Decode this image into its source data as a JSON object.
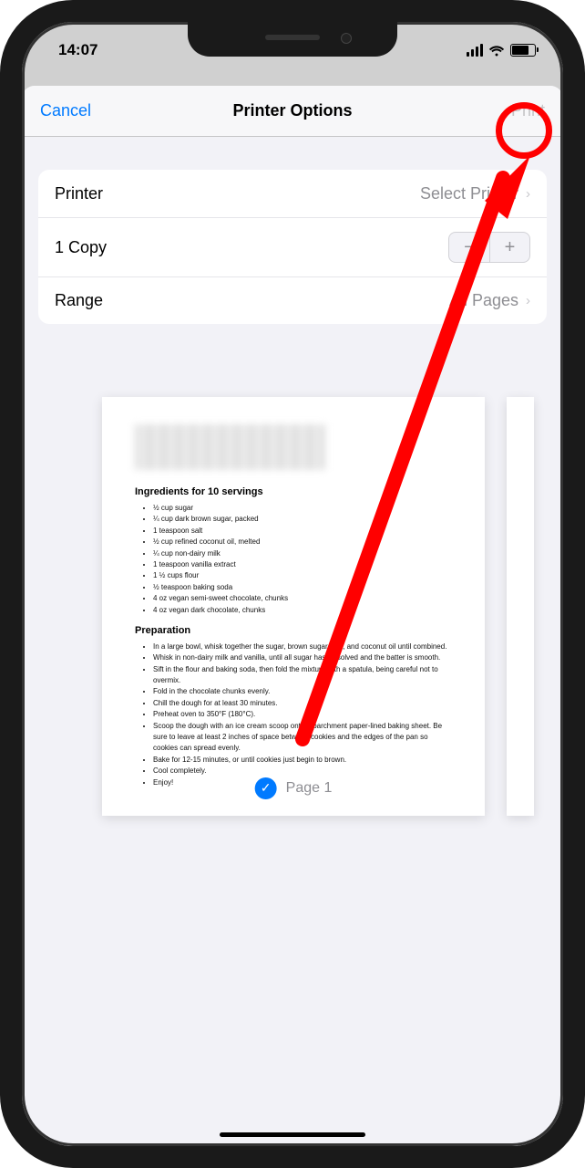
{
  "statusBar": {
    "time": "14:07"
  },
  "nav": {
    "cancel": "Cancel",
    "title": "Printer Options",
    "print": "Print"
  },
  "settings": {
    "printer": {
      "label": "Printer",
      "value": "Select Printer"
    },
    "copies": {
      "label": "1 Copy",
      "minus": "−",
      "plus": "+"
    },
    "range": {
      "label": "Range",
      "value": "All Pages"
    }
  },
  "document": {
    "ingredientsHeading": "Ingredients for 10 servings",
    "ingredients": [
      "½ cup sugar",
      "¼ cup dark brown sugar, packed",
      "1 teaspoon salt",
      "½ cup refined coconut oil, melted",
      "¼ cup non-dairy milk",
      "1 teaspoon vanilla extract",
      "1 ½ cups flour",
      "½ teaspoon baking soda",
      "4 oz vegan semi-sweet chocolate, chunks",
      "4 oz vegan dark chocolate, chunks"
    ],
    "preparationHeading": "Preparation",
    "preparation": [
      "In a large bowl, whisk together the sugar, brown sugar, salt, and coconut oil until combined.",
      "Whisk in non-dairy milk and vanilla, until all sugar has dissolved and the batter is smooth.",
      "Sift in the flour and baking soda, then fold the mixture with a spatula, being careful not to overmix.",
      "Fold in the chocolate chunks evenly.",
      "Chill the dough for at least 30 minutes.",
      "Preheat oven to 350°F (180°C).",
      "Scoop the dough with an ice cream scoop onto a parchment paper-lined baking sheet. Be sure to leave at least 2 inches of space between cookies and the edges of the pan so cookies can spread evenly.",
      "Bake for 12-15 minutes, or until cookies just begin to brown.",
      "Cool completely.",
      "Enjoy!"
    ],
    "pageLabel": "Page 1"
  }
}
